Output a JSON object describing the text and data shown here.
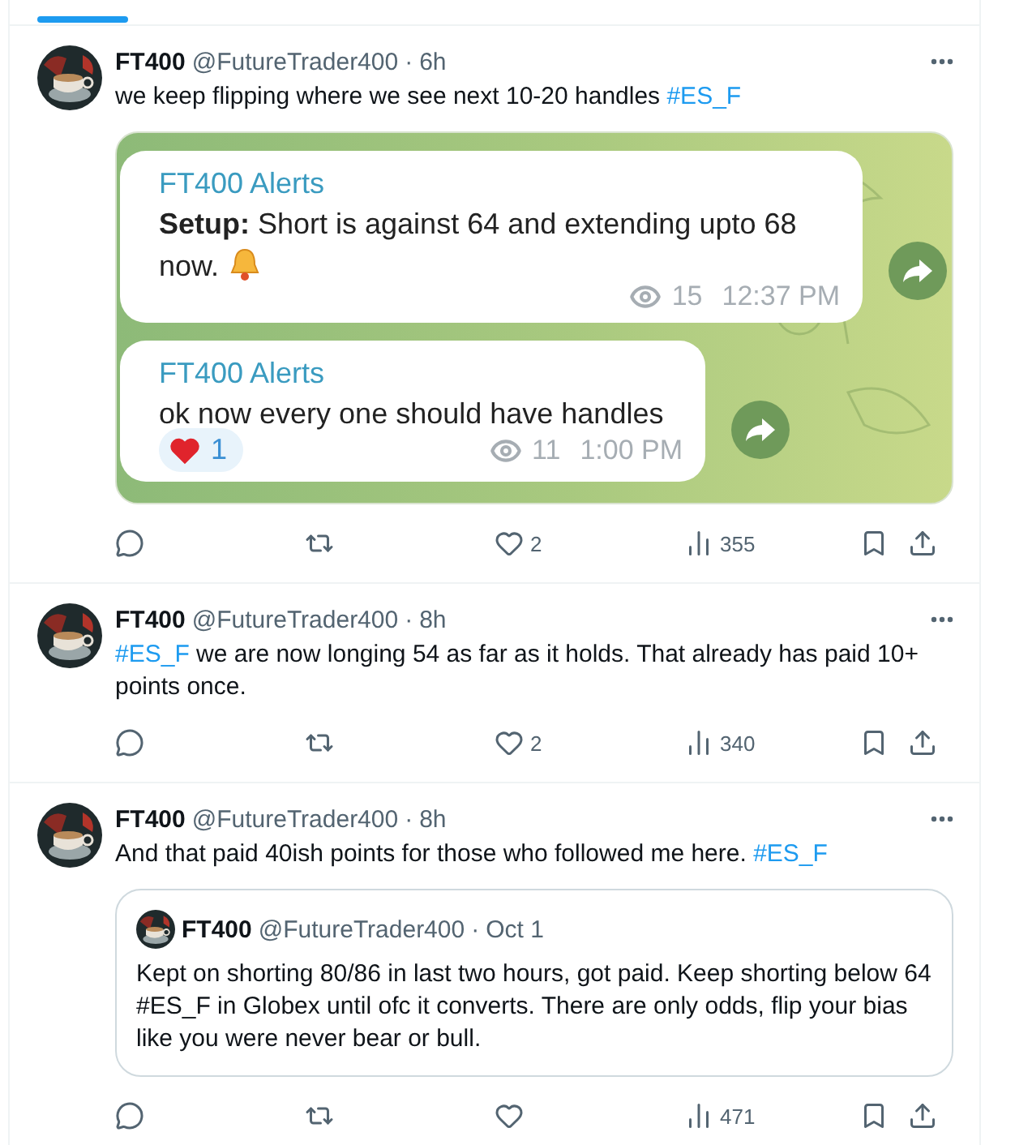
{
  "tweets": [
    {
      "author": "FT400",
      "handle": "@FutureTrader400",
      "separator": "·",
      "time": "6h",
      "text": [
        {
          "kind": "text",
          "text": "we keep flipping where we see next 10-20 handles "
        },
        {
          "kind": "hashtag",
          "text": "#ES_F"
        }
      ],
      "media": {
        "kind": "chat",
        "messages": [
          {
            "sender": "FT400 Alerts",
            "text": "**Setup:** Short is against 64 and extending upto 68 now.",
            "bell": true,
            "views": "15",
            "time": "12:37 PM"
          },
          {
            "sender": "FT400 Alerts",
            "text": "ok now every one should have handles",
            "reaction": "1",
            "views": "11",
            "time": "1:00 PM"
          }
        ]
      },
      "stats": {
        "likes": "2",
        "views": "355"
      }
    },
    {
      "author": "FT400",
      "handle": "@FutureTrader400",
      "separator": "·",
      "time": "8h",
      "text": [
        {
          "kind": "hashtag",
          "text": "#ES_F"
        },
        {
          "kind": "text",
          "text": " we are now longing 54 as far as it holds. That already has paid 10+ points once."
        }
      ],
      "stats": {
        "likes": "2",
        "views": "340"
      }
    },
    {
      "author": "FT400",
      "handle": "@FutureTrader400",
      "separator": "·",
      "time": "8h",
      "text": [
        {
          "kind": "text",
          "text": "And that paid 40ish points for those who followed me here. "
        },
        {
          "kind": "hashtag",
          "text": "#ES_F"
        }
      ],
      "quote": {
        "author": "FT400",
        "handle": "@FutureTrader400",
        "separator": "·",
        "time": "Oct 1",
        "text": "Kept on shorting 80/86 in last two hours, got paid.  Keep shorting below 64 #ES_F in Globex until ofc it converts. There are only odds, flip your bias like you were never bear or bull."
      },
      "stats": {
        "views": "471"
      }
    }
  ]
}
